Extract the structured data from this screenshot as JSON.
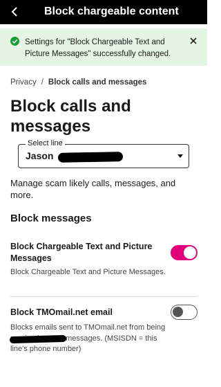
{
  "header": {
    "title": "Block chargeable content",
    "back_icon": "chevron-left-icon"
  },
  "banner": {
    "status_color": "#1a9e3c",
    "message": "Settings for \"Block Chargeable Text and Picture Messages\" successfully changed.",
    "close_icon": "close-icon"
  },
  "breadcrumb": {
    "parent": "Privacy",
    "separator": "/",
    "current": "Block calls and messages"
  },
  "page": {
    "title": "Block calls and messages"
  },
  "line_select": {
    "label": "Select line",
    "value": "Jason"
  },
  "description": "Manage scam likely calls, messages, and more.",
  "section": {
    "title": "Block messages"
  },
  "settings": [
    {
      "title": "Block Chargeable Text and Picture Messages",
      "description": "Block Chargeable Text and Picture Messages.",
      "enabled": true
    },
    {
      "title": "Block TMOmail.net email",
      "description": "Blocks emails sent to TMOmail.net from being received as text messages. (MSISDN = this line's phone number)",
      "enabled": false
    }
  ],
  "colors": {
    "accent": "#e2007a",
    "success_bg": "#e5f5e3",
    "header_bg": "#000000"
  }
}
